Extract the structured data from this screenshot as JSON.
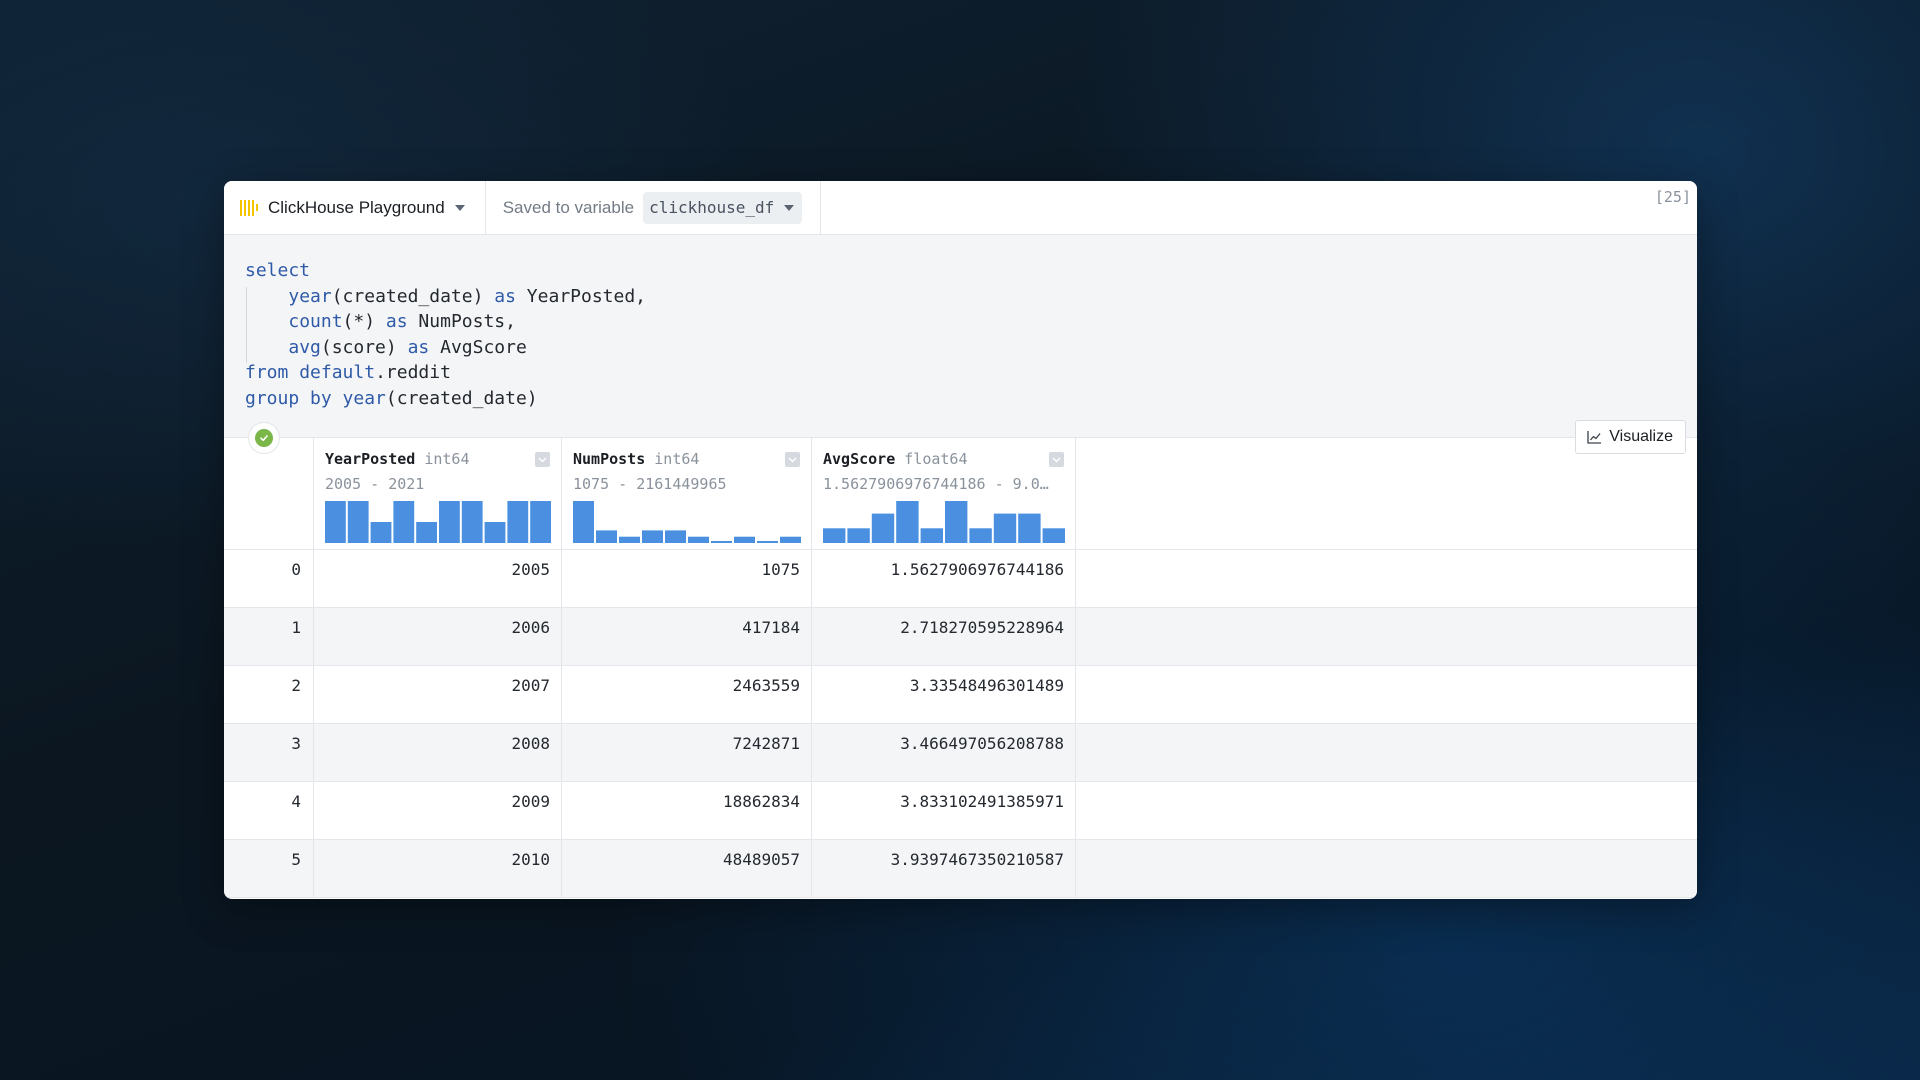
{
  "header": {
    "connection_name": "ClickHouse Playground",
    "saved_label": "Saved to variable",
    "variable_name": "clickhouse_df",
    "exec_count": "[25]"
  },
  "code": {
    "lines": [
      [
        {
          "t": "select",
          "k": true
        }
      ],
      [
        {
          "t": "    "
        },
        {
          "t": "year",
          "k": true
        },
        {
          "t": "(created_date) "
        },
        {
          "t": "as",
          "k": true
        },
        {
          "t": " YearPosted,"
        }
      ],
      [
        {
          "t": "    "
        },
        {
          "t": "count",
          "k": true
        },
        {
          "t": "(*) "
        },
        {
          "t": "as",
          "k": true
        },
        {
          "t": " NumPosts,"
        }
      ],
      [
        {
          "t": "    "
        },
        {
          "t": "avg",
          "k": true
        },
        {
          "t": "(score) "
        },
        {
          "t": "as",
          "k": true
        },
        {
          "t": " AvgScore"
        }
      ],
      [
        {
          "t": "from",
          "k": true
        },
        {
          "t": " "
        },
        {
          "t": "default",
          "k": true
        },
        {
          "t": ".reddit"
        }
      ],
      [
        {
          "t": "group by",
          "k": true
        },
        {
          "t": " "
        },
        {
          "t": "year",
          "k": true
        },
        {
          "t": "(created_date)"
        }
      ]
    ]
  },
  "visualize_label": "Visualize",
  "columns": [
    {
      "name": "YearPosted",
      "type": "int64",
      "range": "2005 - 2021",
      "hist": [
        1,
        1,
        0.5,
        1,
        0.5,
        1,
        1,
        0.5,
        1,
        1
      ]
    },
    {
      "name": "NumPosts",
      "type": "int64",
      "range": "1075 - 2161449965",
      "hist": [
        1,
        0.3,
        0.15,
        0.3,
        0.3,
        0.15,
        0.03,
        0.15,
        0.03,
        0.15
      ]
    },
    {
      "name": "AvgScore",
      "type": "float64",
      "range": "1.5627906976744186 - 9.0…",
      "hist": [
        0.35,
        0.35,
        0.7,
        1,
        0.35,
        1,
        0.35,
        0.7,
        0.7,
        0.35
      ]
    }
  ],
  "rows": [
    {
      "index": "0",
      "YearPosted": "2005",
      "NumPosts": "1075",
      "AvgScore": "1.5627906976744186"
    },
    {
      "index": "1",
      "YearPosted": "2006",
      "NumPosts": "417184",
      "AvgScore": "2.718270595228964"
    },
    {
      "index": "2",
      "YearPosted": "2007",
      "NumPosts": "2463559",
      "AvgScore": "3.33548496301489"
    },
    {
      "index": "3",
      "YearPosted": "2008",
      "NumPosts": "7242871",
      "AvgScore": "3.466497056208788"
    },
    {
      "index": "4",
      "YearPosted": "2009",
      "NumPosts": "18862834",
      "AvgScore": "3.833102491385971"
    },
    {
      "index": "5",
      "YearPosted": "2010",
      "NumPosts": "48489057",
      "AvgScore": "3.9397467350210587"
    }
  ],
  "colors": {
    "accent": "#4a8fe0",
    "keyword": "#2f5aa8",
    "success": "#7ab648",
    "logo": "#f2c500"
  },
  "icons": {
    "connection": "clickhouse-logo-icon",
    "status": "check-circle-icon",
    "visualize": "line-chart-icon",
    "column_menu": "chevron-down-icon"
  }
}
